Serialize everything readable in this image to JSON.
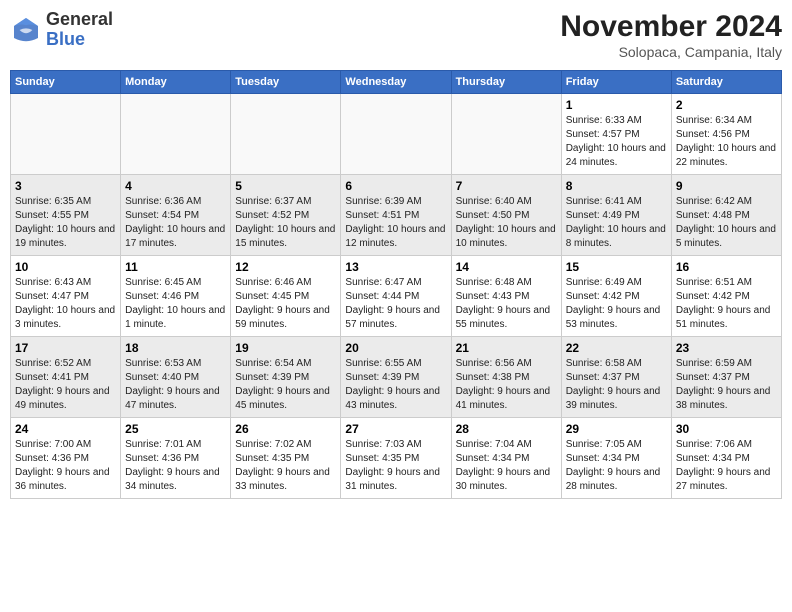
{
  "header": {
    "logo_general": "General",
    "logo_blue": "Blue",
    "month_title": "November 2024",
    "subtitle": "Solopaca, Campania, Italy"
  },
  "days_of_week": [
    "Sunday",
    "Monday",
    "Tuesday",
    "Wednesday",
    "Thursday",
    "Friday",
    "Saturday"
  ],
  "weeks": [
    [
      {
        "day": "",
        "info": ""
      },
      {
        "day": "",
        "info": ""
      },
      {
        "day": "",
        "info": ""
      },
      {
        "day": "",
        "info": ""
      },
      {
        "day": "",
        "info": ""
      },
      {
        "day": "1",
        "info": "Sunrise: 6:33 AM\nSunset: 4:57 PM\nDaylight: 10 hours and 24 minutes."
      },
      {
        "day": "2",
        "info": "Sunrise: 6:34 AM\nSunset: 4:56 PM\nDaylight: 10 hours and 22 minutes."
      }
    ],
    [
      {
        "day": "3",
        "info": "Sunrise: 6:35 AM\nSunset: 4:55 PM\nDaylight: 10 hours and 19 minutes."
      },
      {
        "day": "4",
        "info": "Sunrise: 6:36 AM\nSunset: 4:54 PM\nDaylight: 10 hours and 17 minutes."
      },
      {
        "day": "5",
        "info": "Sunrise: 6:37 AM\nSunset: 4:52 PM\nDaylight: 10 hours and 15 minutes."
      },
      {
        "day": "6",
        "info": "Sunrise: 6:39 AM\nSunset: 4:51 PM\nDaylight: 10 hours and 12 minutes."
      },
      {
        "day": "7",
        "info": "Sunrise: 6:40 AM\nSunset: 4:50 PM\nDaylight: 10 hours and 10 minutes."
      },
      {
        "day": "8",
        "info": "Sunrise: 6:41 AM\nSunset: 4:49 PM\nDaylight: 10 hours and 8 minutes."
      },
      {
        "day": "9",
        "info": "Sunrise: 6:42 AM\nSunset: 4:48 PM\nDaylight: 10 hours and 5 minutes."
      }
    ],
    [
      {
        "day": "10",
        "info": "Sunrise: 6:43 AM\nSunset: 4:47 PM\nDaylight: 10 hours and 3 minutes."
      },
      {
        "day": "11",
        "info": "Sunrise: 6:45 AM\nSunset: 4:46 PM\nDaylight: 10 hours and 1 minute."
      },
      {
        "day": "12",
        "info": "Sunrise: 6:46 AM\nSunset: 4:45 PM\nDaylight: 9 hours and 59 minutes."
      },
      {
        "day": "13",
        "info": "Sunrise: 6:47 AM\nSunset: 4:44 PM\nDaylight: 9 hours and 57 minutes."
      },
      {
        "day": "14",
        "info": "Sunrise: 6:48 AM\nSunset: 4:43 PM\nDaylight: 9 hours and 55 minutes."
      },
      {
        "day": "15",
        "info": "Sunrise: 6:49 AM\nSunset: 4:42 PM\nDaylight: 9 hours and 53 minutes."
      },
      {
        "day": "16",
        "info": "Sunrise: 6:51 AM\nSunset: 4:42 PM\nDaylight: 9 hours and 51 minutes."
      }
    ],
    [
      {
        "day": "17",
        "info": "Sunrise: 6:52 AM\nSunset: 4:41 PM\nDaylight: 9 hours and 49 minutes."
      },
      {
        "day": "18",
        "info": "Sunrise: 6:53 AM\nSunset: 4:40 PM\nDaylight: 9 hours and 47 minutes."
      },
      {
        "day": "19",
        "info": "Sunrise: 6:54 AM\nSunset: 4:39 PM\nDaylight: 9 hours and 45 minutes."
      },
      {
        "day": "20",
        "info": "Sunrise: 6:55 AM\nSunset: 4:39 PM\nDaylight: 9 hours and 43 minutes."
      },
      {
        "day": "21",
        "info": "Sunrise: 6:56 AM\nSunset: 4:38 PM\nDaylight: 9 hours and 41 minutes."
      },
      {
        "day": "22",
        "info": "Sunrise: 6:58 AM\nSunset: 4:37 PM\nDaylight: 9 hours and 39 minutes."
      },
      {
        "day": "23",
        "info": "Sunrise: 6:59 AM\nSunset: 4:37 PM\nDaylight: 9 hours and 38 minutes."
      }
    ],
    [
      {
        "day": "24",
        "info": "Sunrise: 7:00 AM\nSunset: 4:36 PM\nDaylight: 9 hours and 36 minutes."
      },
      {
        "day": "25",
        "info": "Sunrise: 7:01 AM\nSunset: 4:36 PM\nDaylight: 9 hours and 34 minutes."
      },
      {
        "day": "26",
        "info": "Sunrise: 7:02 AM\nSunset: 4:35 PM\nDaylight: 9 hours and 33 minutes."
      },
      {
        "day": "27",
        "info": "Sunrise: 7:03 AM\nSunset: 4:35 PM\nDaylight: 9 hours and 31 minutes."
      },
      {
        "day": "28",
        "info": "Sunrise: 7:04 AM\nSunset: 4:34 PM\nDaylight: 9 hours and 30 minutes."
      },
      {
        "day": "29",
        "info": "Sunrise: 7:05 AM\nSunset: 4:34 PM\nDaylight: 9 hours and 28 minutes."
      },
      {
        "day": "30",
        "info": "Sunrise: 7:06 AM\nSunset: 4:34 PM\nDaylight: 9 hours and 27 minutes."
      }
    ]
  ]
}
